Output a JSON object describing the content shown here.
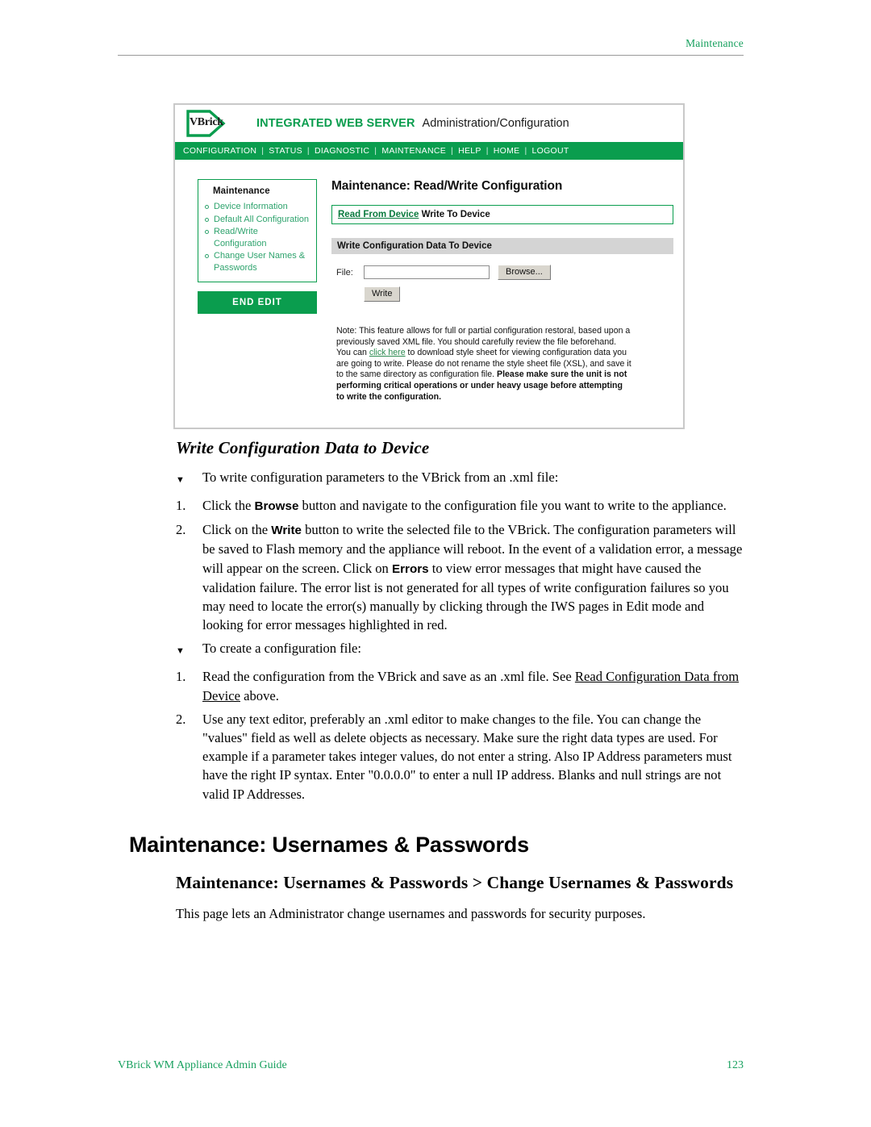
{
  "running_header": {
    "text": "Maintenance"
  },
  "footer": {
    "guide_title": "VBrick WM Appliance Admin Guide",
    "page_number": "123"
  },
  "colors": {
    "brand_green": "#0a9d4e",
    "header_green": "#17a05e",
    "link_green": "#2ea36d",
    "section_gray": "#d4d4d4"
  },
  "screenshot": {
    "brandbar": {
      "logo_text": "VBrick",
      "title": "INTEGRATED WEB SERVER",
      "subtitle": "Administration/Configuration"
    },
    "navbar": {
      "items": [
        "CONFIGURATION",
        "STATUS",
        "DIAGNOSTIC",
        "MAINTENANCE",
        "HELP",
        "HOME",
        "LOGOUT"
      ]
    },
    "sidebar": {
      "title": "Maintenance",
      "links": [
        "Device Information",
        "Default All Configuration",
        "Read/Write Configuration",
        "Change User Names & Passwords"
      ],
      "end_edit_label": "END EDIT"
    },
    "main": {
      "page_title": "Maintenance: Read/Write Configuration",
      "tabs": {
        "read_label": "Read From Device",
        "write_label": "Write To Device"
      },
      "section_header": "Write Configuration Data To Device",
      "form": {
        "file_label": "File:",
        "file_value": "",
        "file_placeholder": "",
        "browse_label": "Browse...",
        "write_label": "Write"
      },
      "note": {
        "part1": "Note: This feature allows for full or partial configuration restoral, based upon a previously saved XML file. You should carefully review the file beforehand. You can ",
        "link": "click here",
        "part2": " to download style sheet for viewing configuration data you are going to write. Please do not rename the style sheet file (XSL), and save it to the same directory as configuration file. ",
        "bold": "Please make sure the unit is not performing critical operations or under heavy usage before attempting to write the configuration."
      }
    }
  },
  "doc": {
    "sub_head": "Write Configuration Data to Device",
    "intro_bullet_1": "To write configuration parameters to the VBrick from an .xml file:",
    "list1": [
      {
        "num": "1.",
        "pre": "Click the ",
        "bold": "Browse",
        "post": " button and navigate to the configuration file you want to write to the appliance."
      },
      {
        "num": "2.",
        "pre": "Click on the ",
        "bold": "Write",
        "mid": " button to write the selected file to the VBrick. The configuration parameters will be saved to Flash memory and the appliance will reboot. In the event of a validation error, a message will appear on the screen. Click on ",
        "bold2": "Errors",
        "post": " to view error messages that might have caused the validation failure. The error list is not generated for all types of write configuration failures so you may need to locate the error(s) manually by clicking through the IWS pages in Edit mode and looking for error messages highlighted in red."
      }
    ],
    "intro_bullet_2": "To create a configuration file:",
    "list2": [
      {
        "num": "1.",
        "pre": "Read the configuration from the VBrick and save as an .xml file. See ",
        "xref": "Read Configuration Data from Device",
        "post": " above."
      },
      {
        "num": "2.",
        "pre": "Use any text editor, preferably an .xml editor to make changes to the file. You can change the \"values\" field as well as delete objects as necessary. Make sure the right data types are used. For example if a parameter takes integer values, do not enter a string. Also IP Address parameters must have the right IP syntax. Enter \"0.0.0.0\" to enter a null IP address. Blanks and null strings are not valid IP Addresses."
      }
    ],
    "chapter_head": "Maintenance: Usernames & Passwords",
    "section_head": "Maintenance: Usernames & Passwords > Change Usernames & Passwords",
    "body_para": "This page lets an Administrator change usernames and passwords for security purposes.",
    "triangle_glyph": "▼"
  }
}
